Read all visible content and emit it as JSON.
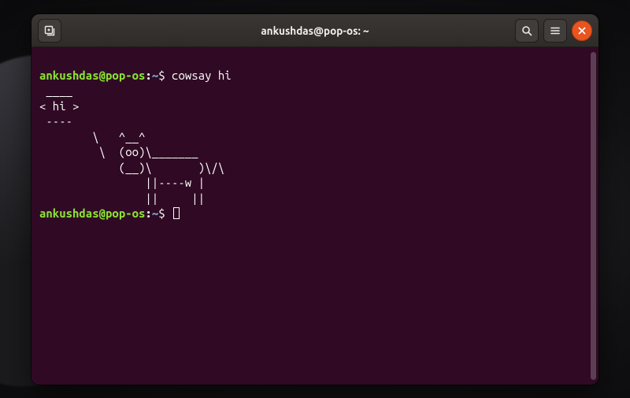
{
  "window": {
    "title": "ankushdas@pop-os: ~"
  },
  "prompt": {
    "user": "ankushdas",
    "at": "@",
    "host": "pop-os",
    "colon": ":",
    "path": "~",
    "dollar": "$ "
  },
  "lines": {
    "cmd1": "cowsay hi",
    "out1": " ____ ",
    "out2": "< hi >",
    "out3": " ---- ",
    "out4": "        \\   ^__^",
    "out5": "         \\  (oo)\\_______",
    "out6": "            (__)\\       )\\/\\",
    "out7": "                ||----w |",
    "out8": "                ||     ||"
  },
  "icons": {
    "newtab": "new-tab-icon",
    "search": "search-icon",
    "menu": "hamburger-icon",
    "close": "close-icon"
  },
  "colors": {
    "bg": "#300a24",
    "prompt_user": "#8ae234",
    "prompt_path": "#729fcf",
    "close_btn": "#e95420"
  }
}
